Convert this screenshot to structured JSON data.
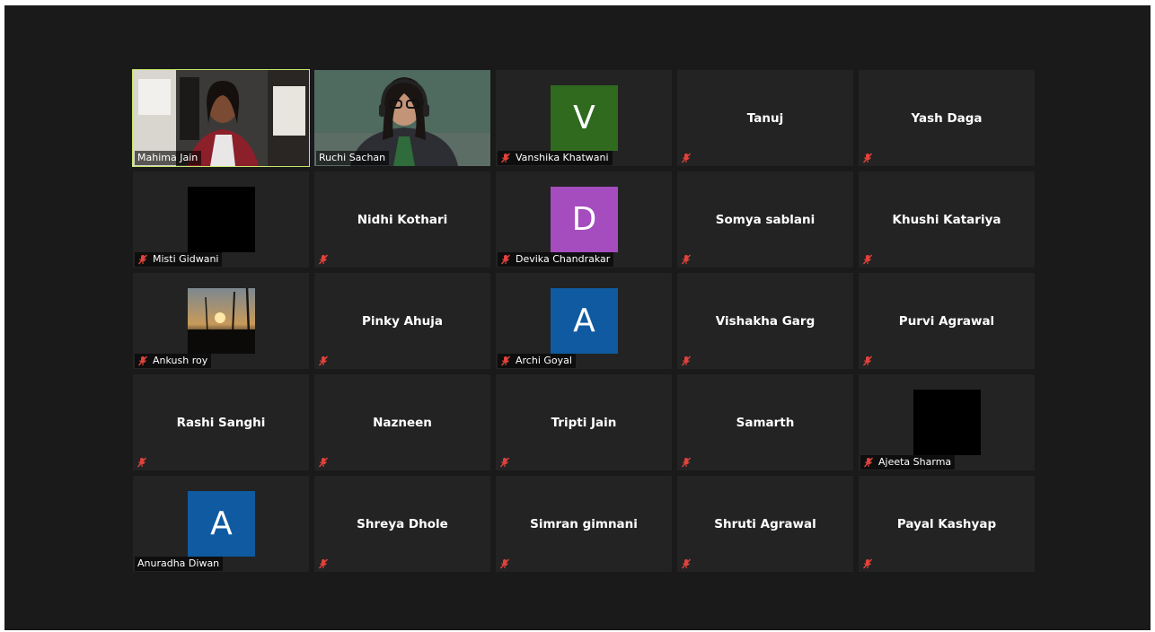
{
  "colors": {
    "background": "#1a1a1a",
    "tile": "#232323",
    "active_speaker_border": "#c6e86b",
    "muted_icon": "#e0433b",
    "avatar_green": "#2f6a1f",
    "avatar_purple": "#a54cbf",
    "avatar_blue": "#0f5aa0"
  },
  "participants": [
    {
      "name": "Mahima Jain",
      "kind": "video",
      "muted": false,
      "active": true
    },
    {
      "name": "Ruchi Sachan",
      "kind": "video",
      "muted": false
    },
    {
      "name": "Vanshika Khatwani",
      "kind": "avatar",
      "initial": "V",
      "color": "#2f6a1f",
      "muted": true
    },
    {
      "name": "Tanuj",
      "kind": "name",
      "muted": true
    },
    {
      "name": "Yash Daga",
      "kind": "name",
      "muted": true
    },
    {
      "name": "Misti Gidwani",
      "kind": "blank",
      "muted": true
    },
    {
      "name": "Nidhi Kothari",
      "kind": "name",
      "muted": true
    },
    {
      "name": "Devika Chandrakar",
      "kind": "avatar",
      "initial": "D",
      "color": "#a54cbf",
      "muted": true
    },
    {
      "name": "Somya sablani",
      "kind": "name",
      "muted": true
    },
    {
      "name": "Khushi Katariya",
      "kind": "name",
      "muted": true
    },
    {
      "name": "Ankush roy",
      "kind": "photo",
      "muted": true
    },
    {
      "name": "Pinky Ahuja",
      "kind": "name",
      "muted": true
    },
    {
      "name": "Archi Goyal",
      "kind": "avatar",
      "initial": "A",
      "color": "#0f5aa0",
      "muted": true
    },
    {
      "name": "Vishakha Garg",
      "kind": "name",
      "muted": true
    },
    {
      "name": "Purvi Agrawal",
      "kind": "name",
      "muted": true
    },
    {
      "name": "Rashi Sanghi",
      "kind": "name",
      "muted": true
    },
    {
      "name": "Nazneen",
      "kind": "name",
      "muted": true
    },
    {
      "name": "Tripti Jain",
      "kind": "name",
      "muted": true
    },
    {
      "name": "Samarth",
      "kind": "name",
      "muted": true
    },
    {
      "name": "Ajeeta Sharma",
      "kind": "blank",
      "muted": true
    },
    {
      "name": "Anuradha Diwan",
      "kind": "avatar",
      "initial": "A",
      "color": "#0f5aa0",
      "muted": false
    },
    {
      "name": "Shreya Dhole",
      "kind": "name",
      "muted": true
    },
    {
      "name": "Simran gimnani",
      "kind": "name",
      "muted": true
    },
    {
      "name": "Shruti Agrawal",
      "kind": "name",
      "muted": true
    },
    {
      "name": "Payal Kashyap",
      "kind": "name",
      "muted": true
    }
  ]
}
